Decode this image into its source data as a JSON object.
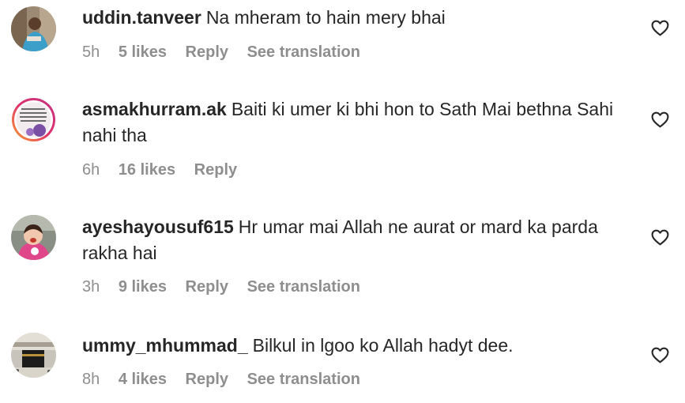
{
  "comments": [
    {
      "username": "uddin.tanveer",
      "text": "Na mheram to hain mery bhai",
      "time": "5h",
      "likes": "5 likes",
      "reply": "Reply",
      "translate": "See translation",
      "avatar_icon": "person-photo-avatar"
    },
    {
      "username": "asmakhurram.ak",
      "text": "Baiti ki umer ki bhi hon to Sath Mai bethna Sahi nahi tha",
      "time": "6h",
      "likes": "16 likes",
      "reply": "Reply",
      "avatar_icon": "story-ring-avatar"
    },
    {
      "username": "ayeshayousuf615",
      "text": "Hr umar mai Allah ne aurat or mard ka parda rakha hai",
      "time": "3h",
      "likes": "9 likes",
      "reply": "Reply",
      "translate": "See translation",
      "avatar_icon": "child-photo-avatar"
    },
    {
      "username": "ummy_mhummad_",
      "text": "Bilkul in lgoo ko Allah hadyt dee.",
      "time": "8h",
      "likes": "4 likes",
      "reply": "Reply",
      "translate": "See translation",
      "avatar_icon": "kaaba-photo-avatar"
    }
  ],
  "colors": {
    "text": "#262626",
    "meta": "#8e8e8e",
    "story_ring_start": "#f9a12e",
    "story_ring_end": "#c13584"
  },
  "icons": {
    "like": "heart-outline-icon"
  }
}
